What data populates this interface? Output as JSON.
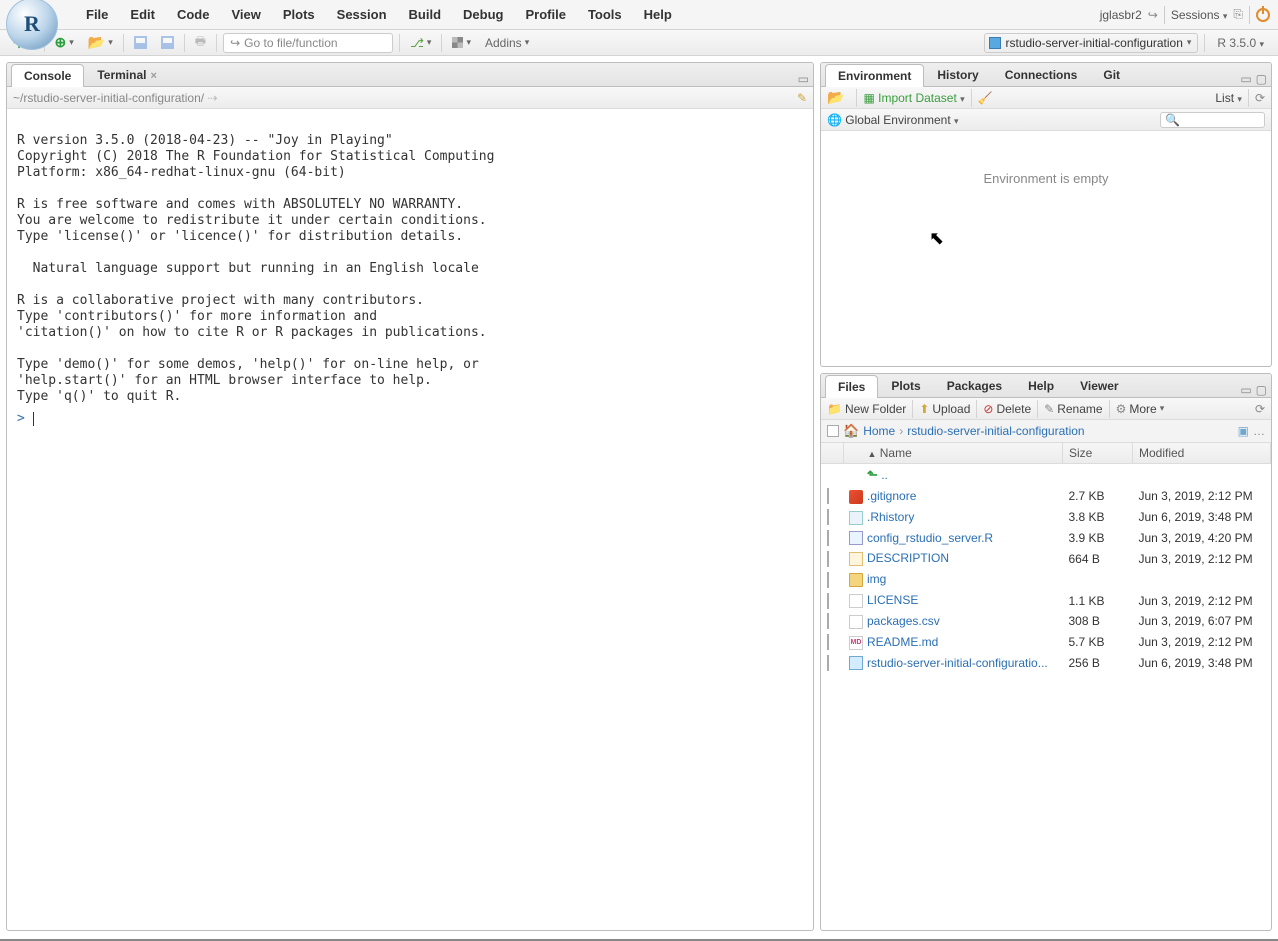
{
  "user": "jglasbr2",
  "sessions_label": "Sessions",
  "menus": [
    "File",
    "Edit",
    "Code",
    "View",
    "Plots",
    "Session",
    "Build",
    "Debug",
    "Profile",
    "Tools",
    "Help"
  ],
  "toolbar": {
    "goto_placeholder": "Go to file/function",
    "addins_label": "Addins"
  },
  "project_name": "rstudio-server-initial-configuration",
  "r_version": "R 3.5.0",
  "left_tabs": {
    "console": "Console",
    "terminal": "Terminal"
  },
  "console_path": "~/rstudio-server-initial-configuration/",
  "console_text": "\nR version 3.5.0 (2018-04-23) -- \"Joy in Playing\"\nCopyright (C) 2018 The R Foundation for Statistical Computing\nPlatform: x86_64-redhat-linux-gnu (64-bit)\n\nR is free software and comes with ABSOLUTELY NO WARRANTY.\nYou are welcome to redistribute it under certain conditions.\nType 'license()' or 'licence()' for distribution details.\n\n  Natural language support but running in an English locale\n\nR is a collaborative project with many contributors.\nType 'contributors()' for more information and\n'citation()' on how to cite R or R packages in publications.\n\nType 'demo()' for some demos, 'help()' for on-line help, or\n'help.start()' for an HTML browser interface to help.\nType 'q()' to quit R.\n",
  "prompt": ">",
  "env_tabs": [
    "Environment",
    "History",
    "Connections",
    "Git"
  ],
  "env_toolbar": {
    "import": "Import Dataset",
    "scope": "Global Environment",
    "view_mode": "List"
  },
  "env_empty": "Environment is empty",
  "files_tabs": [
    "Files",
    "Plots",
    "Packages",
    "Help",
    "Viewer"
  ],
  "files_toolbar": {
    "newfolder": "New Folder",
    "upload": "Upload",
    "delete": "Delete",
    "rename": "Rename",
    "more": "More"
  },
  "breadcrumb": {
    "home": "Home",
    "dir": "rstudio-server-initial-configuration"
  },
  "cols": {
    "name": "Name",
    "size": "Size",
    "modified": "Modified"
  },
  "parent": "..",
  "files": [
    {
      "icon": "git",
      "name": ".gitignore",
      "size": "2.7 KB",
      "mod": "Jun 3, 2019, 2:12 PM"
    },
    {
      "icon": "r",
      "name": ".Rhistory",
      "size": "3.8 KB",
      "mod": "Jun 6, 2019, 3:48 PM"
    },
    {
      "icon": "rfile",
      "name": "config_rstudio_server.R",
      "size": "3.9 KB",
      "mod": "Jun 3, 2019, 4:20 PM"
    },
    {
      "icon": "desc",
      "name": "DESCRIPTION",
      "size": "664 B",
      "mod": "Jun 3, 2019, 2:12 PM"
    },
    {
      "icon": "folder",
      "name": "img",
      "size": "",
      "mod": ""
    },
    {
      "icon": "txt",
      "name": "LICENSE",
      "size": "1.1 KB",
      "mod": "Jun 3, 2019, 2:12 PM"
    },
    {
      "icon": "csv",
      "name": "packages.csv",
      "size": "308 B",
      "mod": "Jun 3, 2019, 6:07 PM"
    },
    {
      "icon": "md",
      "name": "README.md",
      "size": "5.7 KB",
      "mod": "Jun 3, 2019, 2:12 PM"
    },
    {
      "icon": "proj",
      "name": "rstudio-server-initial-configuratio...",
      "size": "256 B",
      "mod": "Jun 6, 2019, 3:48 PM"
    }
  ]
}
